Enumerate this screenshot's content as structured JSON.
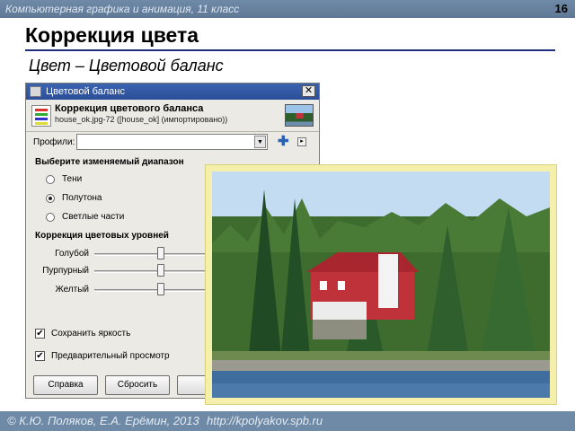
{
  "slide": {
    "header_text": "Компьютерная графика и анимация, 11 класс",
    "page_number": "16",
    "title": "Коррекция цвета",
    "subtitle": "Цвет – Цветовой баланс",
    "footer_authors": "© К.Ю. Поляков, Е.А. Ерёмин, 2013",
    "footer_url": "http://kpolyakov.spb.ru"
  },
  "dialog": {
    "window_title": "Цветовой баланс",
    "close_glyph": "✕",
    "header_title": "Коррекция цветового баланса",
    "header_subtitle": "house_ok.jpg-72 ([house_ok] (импортировано))",
    "profiles_label": "Профили:",
    "profiles_value": "",
    "range_section": "Выберите изменяемый диапазон",
    "ranges": [
      {
        "label": "Тени",
        "selected": false
      },
      {
        "label": "Полутона",
        "selected": true
      },
      {
        "label": "Светлые части",
        "selected": false
      }
    ],
    "levels_section": "Коррекция цветовых уровней",
    "sliders": [
      {
        "label": "Голубой",
        "value": 0
      },
      {
        "label": "Пурпурный",
        "value": 0
      },
      {
        "label": "Желтый",
        "value": 0
      }
    ],
    "preserve_label": "Сохранить яркость",
    "preserve_checked": true,
    "preview_label": "Предварительный просмотр",
    "preview_checked": true,
    "buttons": {
      "help": "Справка",
      "reset": "Сбросить"
    },
    "check_glyph": "✔",
    "combo_arrow": "▼",
    "plus_glyph": "✚"
  },
  "colors": {
    "header_bar": "#6f8aa6",
    "title_rule": "#1f2f80",
    "dialog_bg": "#eceae4",
    "photo_frame": "#f4efaa",
    "house_red": "#c0323a"
  }
}
